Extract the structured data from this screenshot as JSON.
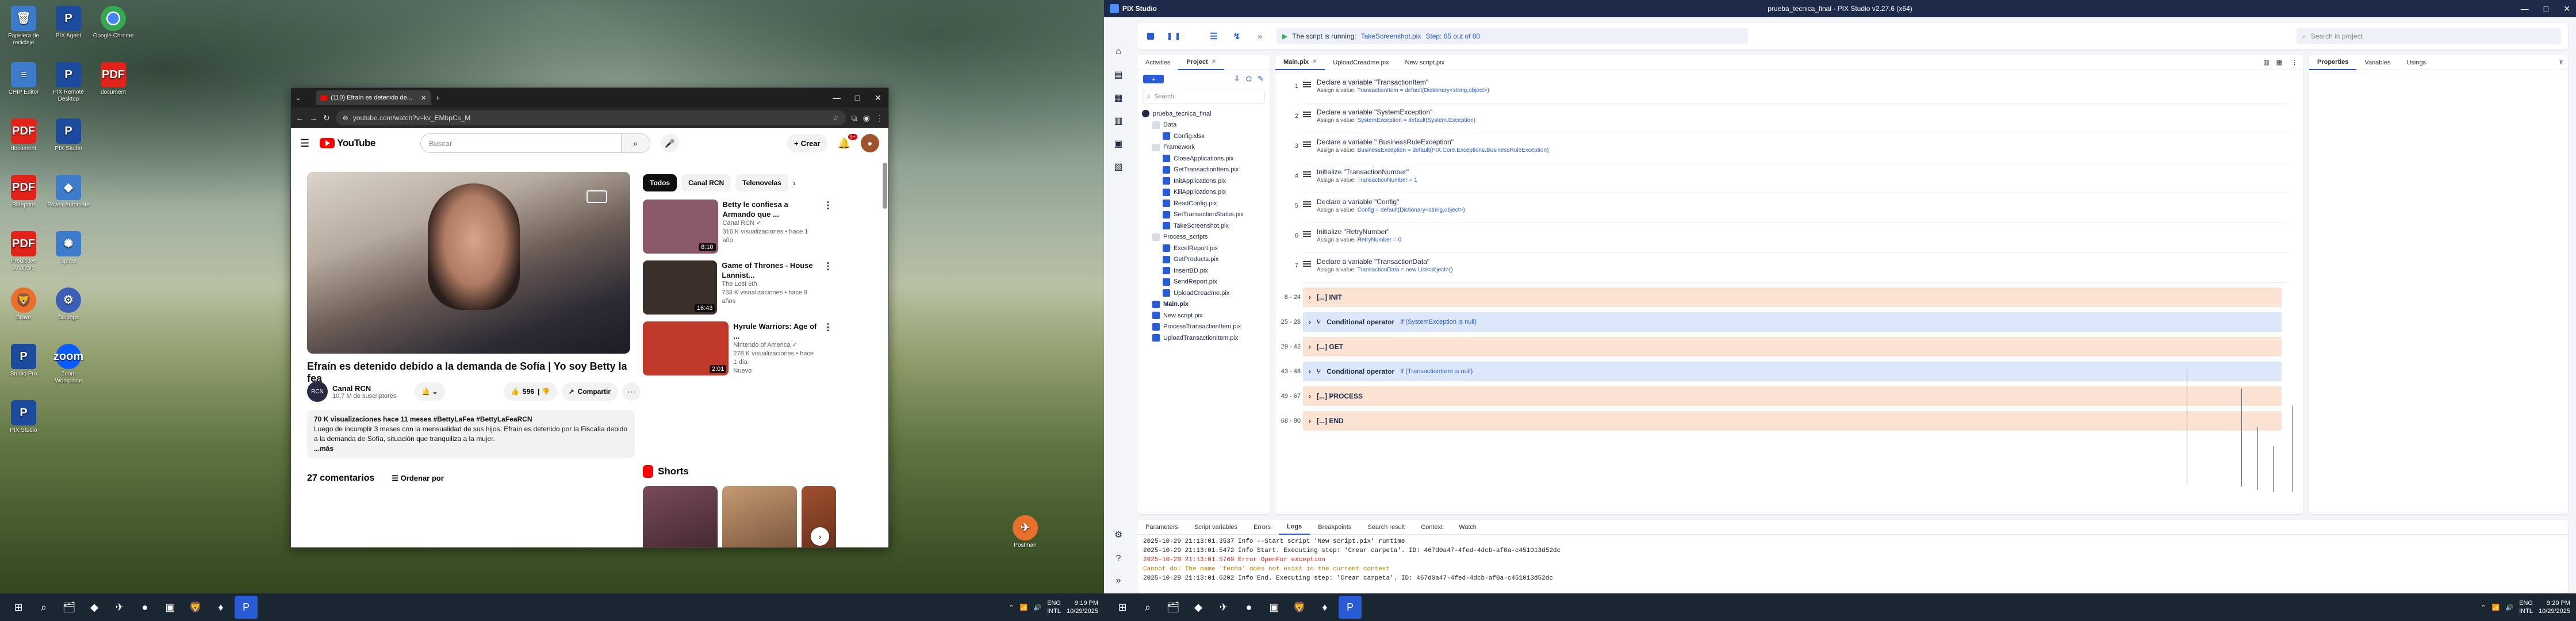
{
  "desktop": {
    "icons": [
      {
        "label": "Papelera de reciclaje",
        "glyph": "🗑",
        "cls": "g-app"
      },
      {
        "label": "PIX Agent",
        "glyph": "P",
        "cls": "g-pix"
      },
      {
        "label": "Google Chrome",
        "glyph": "",
        "cls": "g-chrome"
      },
      {
        "label": "CHIP Editor",
        "glyph": "≡",
        "cls": "g-app"
      },
      {
        "label": "PIX Remote Desktop",
        "glyph": "P",
        "cls": "g-pix"
      },
      {
        "label": "document",
        "glyph": "PDF",
        "cls": "g-pdf"
      },
      {
        "label": "document",
        "glyph": "PDF",
        "cls": "g-pdf"
      },
      {
        "label": "PIX Studio",
        "glyph": "P",
        "cls": "g-pix"
      },
      {
        "label": "Blueprint",
        "glyph": "PDF",
        "cls": "g-pdf"
      },
      {
        "label": "Power Automate",
        "glyph": "◆",
        "cls": "g-app"
      },
      {
        "label": "Predictive Analysis",
        "glyph": "PDF",
        "cls": "g-pdf"
      },
      {
        "label": "Spirax",
        "glyph": "✺",
        "cls": "g-app"
      },
      {
        "label": "Brave",
        "glyph": "🦁",
        "cls": "g-orange"
      },
      {
        "label": "Settings",
        "glyph": "⚙",
        "cls": "g-gear"
      },
      {
        "label": "Studio Pro",
        "glyph": "P",
        "cls": "g-pix"
      },
      {
        "label": "Zoom Workplace",
        "glyph": "zoom",
        "cls": "g-zoom"
      },
      {
        "label": "PIX Studio",
        "glyph": "P",
        "cls": "g-pix"
      },
      {
        "label": "Postman",
        "glyph": "✈",
        "cls": "g-orange"
      }
    ]
  },
  "chrome": {
    "tab_title": "(110) Efraín es detenido de...",
    "url": "youtube.com/watch?v=kv_EMbpCs_M",
    "win_controls": [
      "—",
      "□",
      "✕"
    ]
  },
  "youtube": {
    "search_placeholder": "Buscar",
    "create_label": "Crear",
    "notif_count": "9+",
    "logo_text": "YouTube",
    "video_title": "Efraín es detenido debido a la demanda de Sofía | Yo soy Betty la fea",
    "channel_name": "Canal RCN",
    "channel_subs": "10,7 M de suscriptores",
    "likes": "596",
    "share_label": "Compartir",
    "desc_stats": "70 K visualizaciones  hace 11 meses  #BettyLaFea #BettyLaFeaRCN",
    "desc_text": "Luego de incumplir 3 meses con la mensualidad de sus hijos, Efraín es detenido por la Fiscalía debido a la demanda de Sofía, situación que tranquiliza a la mujer.",
    "desc_more": "...más",
    "comments_count": "27 comentarios",
    "sort_label": "Ordenar por",
    "chips": [
      "Todos",
      "Canal RCN",
      "Telenovelas"
    ],
    "recos": [
      {
        "title": "Betty le confiesa a Armando que ...",
        "channel": "Canal RCN ✓",
        "meta": "316 K visualizaciones • hace 1 año",
        "dur": "8:10",
        "color": "#8a5a6a"
      },
      {
        "title": "Game of Thrones - House Lannist...",
        "channel": "The Lost 6th",
        "meta": "733 K visualizaciones • hace 9 años",
        "dur": "16:43",
        "color": "#3b2f2a"
      },
      {
        "title": "Hyrule Warriors: Age of ...",
        "channel": "Nintendo of America ✓",
        "meta": "278 K visualizaciones • hace 1 día",
        "dur": "2:01",
        "color": "#c0392b",
        "badge": "Nuevo"
      }
    ],
    "shorts_label": "Shorts"
  },
  "left_taskbar": {
    "icons": [
      "⊞",
      "⌕",
      "🗂",
      "◆",
      "✈",
      "●",
      "▣",
      "🦁",
      "♦",
      "P"
    ],
    "lang": "ENG",
    "lang2": "INTL",
    "time": "9:19 PM",
    "date": "10/29/2025"
  },
  "pix": {
    "window_title": "prueba_tecnica_final - PIX Studio v2.27.6 (x64)",
    "app_name": "PIX Studio",
    "status_text": "The script is running:",
    "status_file": "TakeScreenshot.pix",
    "status_step": "Step: 65 out of 80",
    "search_placeholder": "Search in project",
    "left_tabs": [
      "Activities",
      "Project"
    ],
    "tree_search_placeholder": "Search",
    "tree": [
      {
        "label": "prueba_tecnica_final",
        "indent": 0,
        "type": "proj"
      },
      {
        "label": "Data",
        "indent": 1,
        "type": "folder"
      },
      {
        "label": "Config.xlsx",
        "indent": 2,
        "type": "file"
      },
      {
        "label": "Framework",
        "indent": 1,
        "type": "folder"
      },
      {
        "label": "CloseApplications.pix",
        "indent": 2,
        "type": "file"
      },
      {
        "label": "GetTransactionItem.pix",
        "indent": 2,
        "type": "file"
      },
      {
        "label": "InitApplications.pix",
        "indent": 2,
        "type": "file"
      },
      {
        "label": "KillApplications.pix",
        "indent": 2,
        "type": "file"
      },
      {
        "label": "ReadConfig.pix",
        "indent": 2,
        "type": "file"
      },
      {
        "label": "SetTransactionStatus.pix",
        "indent": 2,
        "type": "file"
      },
      {
        "label": "TakeScreenshot.pix",
        "indent": 2,
        "type": "file"
      },
      {
        "label": "Process_scripts",
        "indent": 1,
        "type": "folder"
      },
      {
        "label": "ExcelReport.pix",
        "indent": 2,
        "type": "file"
      },
      {
        "label": "GetProducts.pix",
        "indent": 2,
        "type": "file"
      },
      {
        "label": "InsertBD.pix",
        "indent": 2,
        "type": "file"
      },
      {
        "label": "SendReport.pix",
        "indent": 2,
        "type": "file"
      },
      {
        "label": "UploadCreadme.pix",
        "indent": 2,
        "type": "file"
      },
      {
        "label": "Main.pix",
        "indent": 1,
        "type": "file",
        "bold": true
      },
      {
        "label": "New script.pix",
        "indent": 1,
        "type": "file"
      },
      {
        "label": "ProcessTransactionItem.pix",
        "indent": 1,
        "type": "file"
      },
      {
        "label": "UploadTransactionItem.pix",
        "indent": 1,
        "type": "file"
      }
    ],
    "editor_tabs": [
      "Main.pix",
      "UploadCreadme.pix",
      "New script.pix"
    ],
    "activities": [
      {
        "line": "1",
        "title": "Declare a variable \"TransactionItem\"",
        "sub": "Assign a value: ",
        "val": "TransactionItem = default(Dictionary<string,object>)"
      },
      {
        "line": "2",
        "title": "Declare a variable \"SystemException\"",
        "sub": "Assign a value: ",
        "val": "SystemException = default(System.Exception)"
      },
      {
        "line": "3",
        "title": "Declare a variable \" BusinessRuleException\"",
        "sub": "Assign a value: ",
        "val": "BusinessException = default(PIX.Core.Exceptions.BusinessRuleException)"
      },
      {
        "line": "4",
        "title": "Initialize \"TransactionNumber\"",
        "sub": "Assign a value: ",
        "val": "TransactionNumber = 1"
      },
      {
        "line": "5",
        "title": "Declare a variable \"Config\"",
        "sub": "Assign a value: ",
        "val": "Config = default(Dictionary<string,object>)"
      },
      {
        "line": "6",
        "title": "Initialize \"RetryNumber\"",
        "sub": "Assign a value: ",
        "val": "RetryNumber = 0"
      },
      {
        "line": "7",
        "title": "Declare a variable \"TransactionData\"",
        "sub": "Assign a value: ",
        "val": "TransactionData = new List<object>()"
      }
    ],
    "groups": [
      {
        "lines": "8 - 24",
        "label": "[...] INIT",
        "kind": "orange",
        "cond": ""
      },
      {
        "lines": "25 - 28",
        "label": "Conditional operator",
        "kind": "blue",
        "cond": "If (SystemException is null)"
      },
      {
        "lines": "29 - 42",
        "label": "[...] GET",
        "kind": "orange",
        "cond": ""
      },
      {
        "lines": "43 - 48",
        "label": "Conditional operator",
        "kind": "blue",
        "cond": "If (TransactionItem is null)"
      },
      {
        "lines": "49 - 67",
        "label": "[...] PROCESS",
        "kind": "orange",
        "cond": ""
      },
      {
        "lines": "68 - 80",
        "label": "[...] END",
        "kind": "orange",
        "cond": ""
      }
    ],
    "right_tabs": [
      "Properties",
      "Variables",
      "Usings"
    ],
    "bottom_tabs": [
      "Parameters",
      "Script variables",
      "Errors",
      "Logs",
      "Breakpoints",
      "Search result",
      "Context",
      "Watch"
    ],
    "logs": [
      {
        "text": "2025-10-29 21:13:01.3537 Info --Start script 'New script.pix' runtime",
        "cls": ""
      },
      {
        "text": "2025-10-29 21:13:01.5472 Info Start. Executing step: 'Crear carpeta'. ID: 467d0a47-4fed-4dcb-af0a-c451013d52dc",
        "cls": ""
      },
      {
        "text": "2025-10-29 21:13:01.5769 Error OpenFor exception",
        "cls": "err"
      },
      {
        "text": "Cannot do: The name 'fecha' does not exist in the current context",
        "cls": "warn"
      },
      {
        "text": "2025-10-29 21:13:01.6202 Info End. Executing step: 'Crear carpeta'. ID: 467d0a47-4fed-4dcb-af0a-c451013d52dc",
        "cls": ""
      }
    ]
  },
  "right_taskbar": {
    "icons": [
      "⊞",
      "⌕",
      "🗂",
      "◆",
      "✈",
      "●",
      "▣",
      "🦁",
      "♦",
      "P"
    ],
    "lang": "ENG",
    "lang2": "INTL",
    "time": "9:20 PM",
    "date": "10/29/2025"
  }
}
